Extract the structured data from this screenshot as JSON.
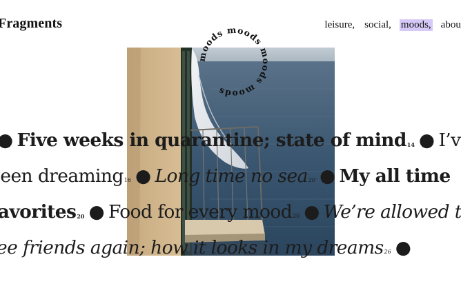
{
  "brand": "Fragments",
  "nav": {
    "items": [
      {
        "label": "leisure,"
      },
      {
        "label": "social,"
      },
      {
        "label": "moods,"
      },
      {
        "label": "about"
      }
    ]
  },
  "ring_label": "moods moods moods moods",
  "articles": [
    {
      "title": "Five weeks in quarantine; state of mind",
      "count": "14",
      "style": "bold"
    },
    {
      "title": "I’ve been dreaming",
      "count": "16",
      "style": "regular"
    },
    {
      "title": "Long time no sea",
      "count": "20",
      "style": "italic"
    },
    {
      "title": "My all time favorites",
      "count": "20",
      "style": "bold"
    },
    {
      "title": "Food for every mood",
      "count": "20",
      "style": "regular"
    },
    {
      "title": "We’re allowed to see friends again; how it looks in my dreams",
      "count": "26",
      "style": "italic"
    }
  ],
  "bullet": "●"
}
